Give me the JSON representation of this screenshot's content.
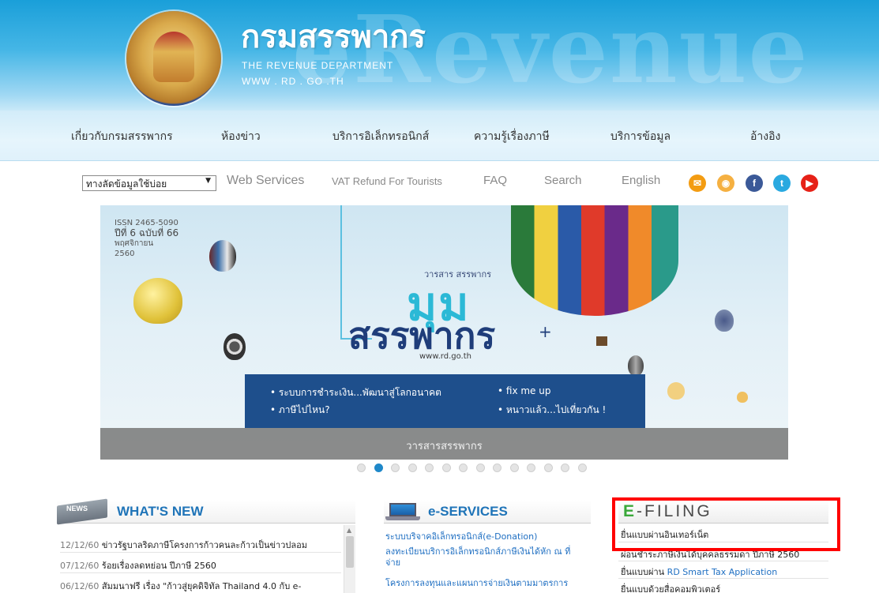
{
  "header": {
    "brand_th": "กรมสรรพากร",
    "brand_en": "THE REVENUE DEPARTMENT",
    "brand_url": "WWW . RD . GO .TH",
    "watermark": "eRevenue"
  },
  "main_nav": [
    {
      "label": "เกี่ยวกับกรมสรรพากร"
    },
    {
      "label": "ห้องข่าว"
    },
    {
      "label": "บริการอิเล็กทรอนิกส์"
    },
    {
      "label": "ความรู้เรื่องภาษี"
    },
    {
      "label": "บริการข้อมูล"
    },
    {
      "label": "อ้างอิง"
    }
  ],
  "sub_nav": {
    "dropdown_value": "ทางลัดข้อมูลใช้บ่อย",
    "links": [
      {
        "label": "Web Services"
      },
      {
        "label": "VAT Refund For Tourists"
      },
      {
        "label": "FAQ"
      },
      {
        "label": "Search"
      },
      {
        "label": "English"
      }
    ],
    "social": [
      {
        "icon": "email-icon",
        "color": "#f39c12"
      },
      {
        "icon": "rss-icon",
        "color": "#f5b041"
      },
      {
        "icon": "facebook-icon",
        "color": "#3b5998"
      },
      {
        "icon": "twitter-icon",
        "color": "#2aa9e0"
      },
      {
        "icon": "youtube-icon",
        "color": "#e62117"
      }
    ]
  },
  "banner": {
    "issn": "ISSN 2465-5090",
    "issue": "ปีที่ 6 ฉบับที่ 66",
    "month": "พฤศจิกายน",
    "year": "2560",
    "mag_small": "วารสาร สรรพากร",
    "mag_mum": "มุม",
    "mag_title": "สรรพากร",
    "mag_url": "www.rd.go.th",
    "topics": [
      "• ระบบการชำระเงิน...พัฒนาสู่โลกอนาคต",
      "• ภาษีไปไหน?",
      "• fix me up",
      "• หนาวแล้ว...ไปเที่ยวกัน !"
    ],
    "caption": "วารสารสรรพากร",
    "slide_count": 14,
    "active_slide": 2
  },
  "whats_new": {
    "badge": "NEWS",
    "title": "WHAT'S NEW",
    "items": [
      {
        "date": "12/12/60",
        "text": "ข่าวรัฐบาลริดภาษีโครงการก้าวคนละก้าวเป็นข่าวปลอม"
      },
      {
        "date": "07/12/60",
        "text": "ร้อยเรื่องลดหย่อน ปีภาษี 2560"
      },
      {
        "date": "06/12/60",
        "text": "สัมมนาฟรี เรื่อง \"ก้าวสู่ยุคดิจิทัล Thailand 4.0 กับ e-"
      }
    ]
  },
  "e_services": {
    "title": "e-SERVICES",
    "links": [
      {
        "text": "ระบบบริจาคอิเล็กทรอนิกส์(e-Donation)"
      },
      {
        "text": "ลงทะเบียนบริการอิเล็กทรอนิกส์ภาษีเงินได้หัก ณ ที่"
      },
      {
        "text": "จ่าย"
      },
      {
        "text": "โครงการลงทุนและแผนการจ่ายเงินตามมาตรการ"
      }
    ]
  },
  "e_filing": {
    "title_e": "E",
    "title_rest": "-FILING",
    "links": [
      {
        "text": "ยื่นแบบผ่านอินเทอร์เน็ต"
      },
      {
        "text": "ผ่อนชำระภาษีเงินได้บุคคลธรรมดา ปีภาษี 2560"
      },
      {
        "text": "ยื่นแบบผ่าน ",
        "blue": "RD Smart Tax Application"
      },
      {
        "text": "ยื่นแบบด้วยสื่อคอมพิวเตอร์"
      }
    ]
  }
}
